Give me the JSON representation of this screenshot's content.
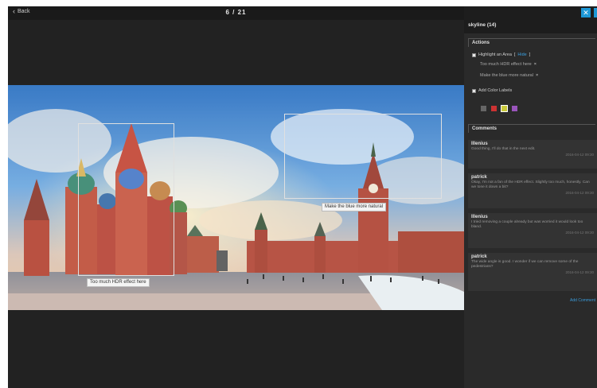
{
  "topbar": {
    "back_label": "Back",
    "counter": "6 / 21"
  },
  "panel": {
    "title": "skyline (14)",
    "actions_header": "Actions",
    "highlight_label": "Highlight an Area",
    "highlight_link": "Hide",
    "highlight_bracket_open": "[",
    "highlight_bracket_close": "]",
    "annotations": [
      {
        "text": "Too much HDR effect here"
      },
      {
        "text": "Make the blue more natural"
      }
    ],
    "remove_symbol": "×",
    "color_labels_label": "Add Color Labels",
    "colors": [
      "#666666",
      "#cc3333",
      "#c8c83a",
      "#9955bb"
    ],
    "comments_header": "Comments",
    "comments": [
      {
        "author": "Illenius",
        "text": "Good thing, I'll do that in the next edit.",
        "time": "2016-04-12 09:30"
      },
      {
        "author": "patrick",
        "text": "Okay, I'm not a fan of the HDR effect. Slightly too much, honestly. Can we tone it down a bit?",
        "time": "2016-04-12 09:30"
      },
      {
        "author": "Illenius",
        "text": "I tried removing a couple already but was worried it would look too bland.",
        "time": "2016-04-12 09:30"
      },
      {
        "author": "patrick",
        "text": "The wide angle is good. I wonder if we can remove some of the pedestrians?",
        "time": "2016-04-12 09:30"
      }
    ],
    "add_comment": "Add Comment"
  },
  "photo_tags": {
    "left": "Too much HDR effect here",
    "right": "Make the blue more natural"
  },
  "icons": {
    "back": "chevron-left-icon",
    "close": "close-icon"
  },
  "accent_color": "#1e98d6"
}
